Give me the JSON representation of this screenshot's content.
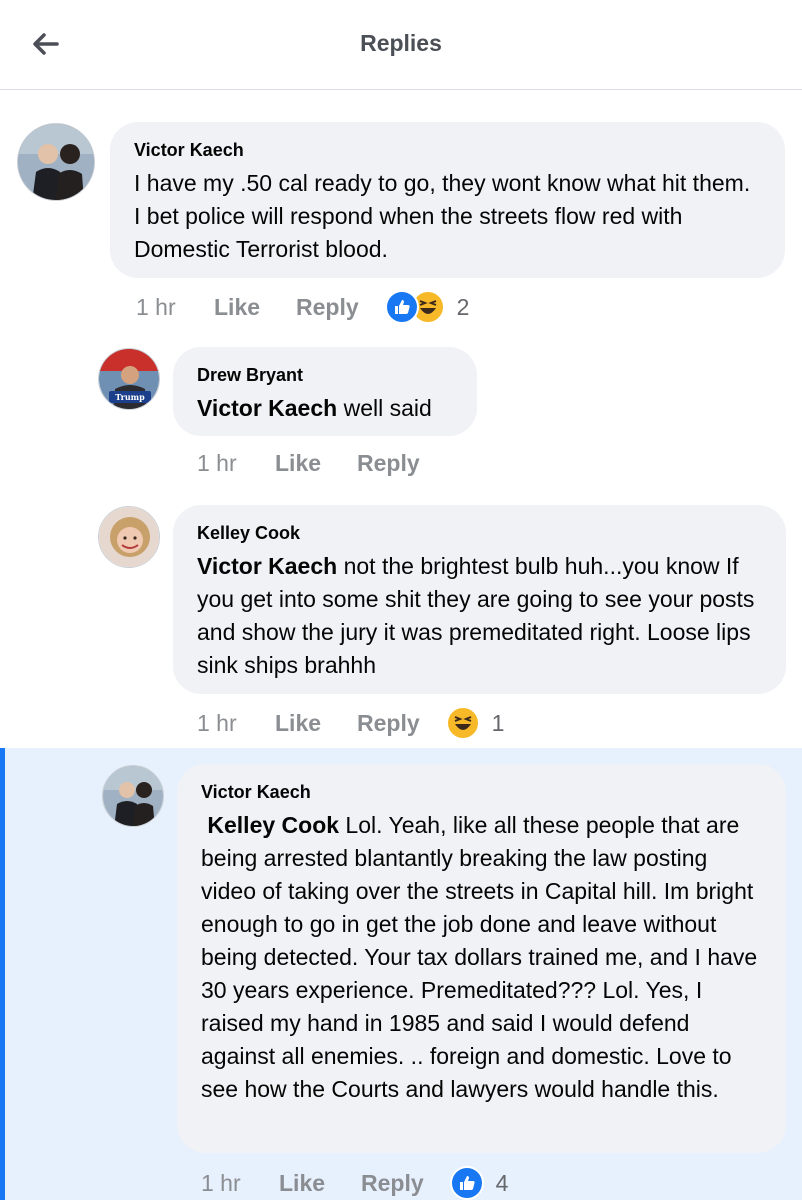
{
  "header": {
    "title": "Replies",
    "back_icon": "arrow-left-icon"
  },
  "colors": {
    "like_blue": "#1877f2",
    "haha_yellow": "#f7b928",
    "highlight_bg": "#e7f0fd",
    "bubble_bg": "#f0f2f5"
  },
  "comments": [
    {
      "author": "Victor Kaech",
      "mention": "",
      "text": "I have my .50 cal ready to go, they wont know what hit them. I bet police will respond when the streets flow red with Domestic Terrorist blood.",
      "time": "1 hr",
      "like_label": "Like",
      "reply_label": "Reply",
      "reactions": [
        "like",
        "haha"
      ],
      "reaction_count": "2"
    },
    {
      "author": "Drew Bryant",
      "mention": "Victor Kaech",
      "text": " well said",
      "time": "1 hr",
      "like_label": "Like",
      "reply_label": "Reply",
      "reactions": [],
      "reaction_count": ""
    },
    {
      "author": "Kelley Cook",
      "mention": "Victor Kaech",
      "text": " not the brightest bulb huh...you know If you get into some shit they are going to see your posts and show the jury it was premeditated right. Loose lips sink ships brahhh",
      "time": "1 hr",
      "like_label": "Like",
      "reply_label": "Reply",
      "reactions": [
        "haha"
      ],
      "reaction_count": "1"
    },
    {
      "author": "Victor Kaech",
      "mention": "Kelley Cook",
      "text": " Lol. Yeah, like all these people that are being arrested blantantly breaking the law posting video of taking over the streets in Capital hill. Im bright enough to go in get the job done and leave without being detected. Your tax dollars trained me, and I have 30 years experience. Premeditated??? Lol. Yes, I raised my hand in 1985 and said I would defend against all enemies. .. foreign and domestic. Love to see how the Courts and lawyers would handle this.",
      "time": "1 hr",
      "like_label": "Like",
      "reply_label": "Reply",
      "reactions": [
        "like"
      ],
      "reaction_count": "4"
    }
  ],
  "avatar_badge_text": "Trump"
}
